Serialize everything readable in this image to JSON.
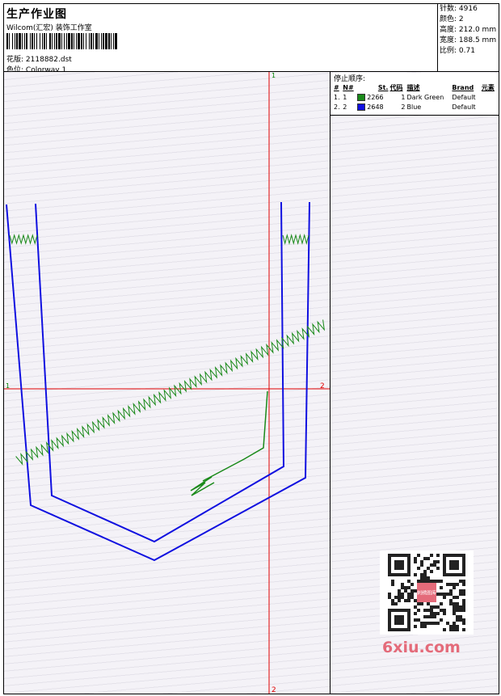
{
  "header": {
    "title": "生产作业图",
    "studio": "Wilcom(汇宏) 装饰工作室",
    "design_label": "花版:",
    "design_value": "2118882.dst",
    "colorway_label": "色位:",
    "colorway_value": "Colorway 1"
  },
  "stats": [
    {
      "label": "针数:",
      "value": "4916"
    },
    {
      "label": "颜色:",
      "value": "2"
    },
    {
      "label": "高度:",
      "value": "212.0 mm"
    },
    {
      "label": "宽度:",
      "value": "188.5 mm"
    },
    {
      "label": "比例:",
      "value": "0.71"
    }
  ],
  "stop_sequence": {
    "title": "停止顺序:",
    "columns": [
      "#",
      "N#",
      "St.",
      "代码",
      "描述",
      "Brand",
      "元素"
    ],
    "rows": [
      {
        "num": "1.",
        "n": "1",
        "stitches": "2266",
        "code": "1",
        "desc": "Dark Green",
        "brand": "Default",
        "color": "#1a8a1a"
      },
      {
        "num": "2.",
        "n": "2",
        "stitches": "2648",
        "code": "2",
        "desc": "Blue",
        "brand": "Default",
        "color": "#1010e0"
      }
    ]
  },
  "crosshair": {
    "top_label": "1",
    "bottom_label": "2",
    "left_label": "1",
    "right_label": "2",
    "color": "#e00000"
  },
  "watermark": "6xiu.com",
  "qr_logo_text": "刺绣图库"
}
